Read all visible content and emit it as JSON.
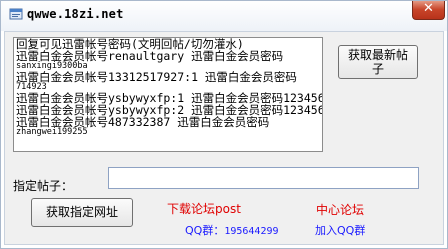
{
  "window": {
    "title": "qwwe.18zi.net",
    "close_symbol": "✕"
  },
  "content": {
    "lines": [
      {
        "text": "回复可见迅雷帐号密码(文明回帖/切勿灌水)",
        "size": "big"
      },
      {
        "text": "迅雷白金会员帐号renaultgary 迅雷白金会员密码",
        "size": "big"
      },
      {
        "text": "sanxingi9300ba",
        "size": "small"
      },
      {
        "text": "迅雷白金会员帐号13312517927:1 迅雷白金会员密码",
        "size": "big"
      },
      {
        "text": "714923",
        "size": "small"
      },
      {
        "text": "迅雷白金会员帐号ysbywyxfp:1 迅雷白金会员密码123456",
        "size": "big"
      },
      {
        "text": "迅雷白金会员帐号ysbywyxfp:2 迅雷白金会员密码123456",
        "size": "big"
      },
      {
        "text": "迅雷白金会员帐号487332387 迅雷白金会员密码",
        "size": "big"
      },
      {
        "text": "zhangwei199255",
        "size": "small"
      }
    ]
  },
  "buttons": {
    "refresh_label": "获取最新帖\n子",
    "fetch_label": "获取指定网址"
  },
  "form": {
    "post_label": "指定帖子：",
    "post_value": ""
  },
  "links": {
    "download_forum": "下载论坛post",
    "center_forum": "中心论坛",
    "qq_group_prefix": "QQ群：",
    "qq_group_number": "195644299",
    "join_qq": "加入QQ群"
  },
  "colors": {
    "red_link": "#e00000",
    "blue_link": "#1a1aff"
  }
}
